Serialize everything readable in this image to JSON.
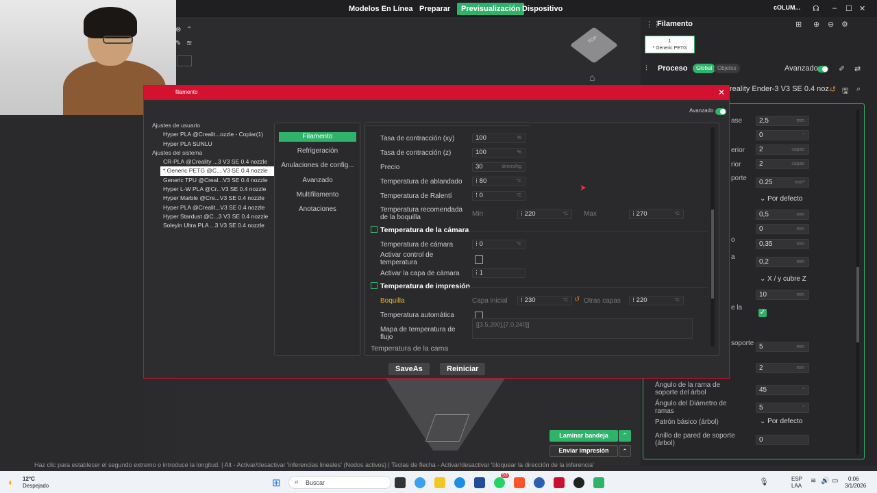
{
  "topbar": {
    "nav": [
      "Modelos En Línea",
      "Preparar",
      "Previsualización",
      "Dispositivo"
    ],
    "active_nav": "Previsualización",
    "user": "cOLUM..."
  },
  "right_panel": {
    "filament_title": "Filamento",
    "filament_slot_number": "1",
    "filament_slot_name": "* Generic PETG",
    "process_title": "Proceso",
    "global_label": "Global",
    "objects_label": "Objetos",
    "advanced_label": "Avanzado",
    "printer_preset": "reality Ender-3 V3 SE 0.4 noz...",
    "rows": [
      {
        "label": "ase",
        "value": "2,5",
        "unit": "mm"
      },
      {
        "label": "",
        "value": "0",
        "unit": "°"
      },
      {
        "label": "erior",
        "value": "2",
        "unit": "capas"
      },
      {
        "label": "rior",
        "value": "2",
        "unit": "capas"
      },
      {
        "label": "porte",
        "value": "0.25",
        "unit": "mm²"
      },
      {
        "label": "",
        "value": "Por defecto",
        "unit": ""
      },
      {
        "label": "",
        "value": "0,5",
        "unit": "mm"
      },
      {
        "label": "",
        "value": "0",
        "unit": "mm"
      },
      {
        "label": "o",
        "value": "0,35",
        "unit": "mm"
      },
      {
        "label": "a",
        "value": "0,2",
        "unit": "mm"
      },
      {
        "label": "",
        "value": "X / y cubre Z",
        "unit": ""
      },
      {
        "label": "",
        "value": "10",
        "unit": "mm"
      },
      {
        "label": "e la",
        "value": "",
        "unit": ""
      },
      {
        "label": "soporte",
        "value": "5",
        "unit": "mm"
      },
      {
        "label": "",
        "value": "2",
        "unit": "mm"
      },
      {
        "label": "Ángulo de la rama de soporte del árbol",
        "value": "45",
        "unit": "°"
      },
      {
        "label": "Ángulo del Diámetro de ramas",
        "value": "5",
        "unit": "°"
      },
      {
        "label": "Patrón básico (árbol)",
        "value": "Por defecto",
        "unit": ""
      },
      {
        "label": "Anillo de pared de soporte (árbol)",
        "value": "0",
        "unit": ""
      }
    ],
    "slice_button": "Laminar bandeja",
    "send_button": "Enviar impresión"
  },
  "viewport": {
    "cube_label": "TOP"
  },
  "status_line": "Haz clic para establecer el segundo extremo o introduce la longitud. | Alt - Activar/desactivar 'inferencias lineales' (Nodos activos) | Teclas de flecha - Activar/desactivar 'bloquear la dirección de la inferencia'",
  "dialog": {
    "title": "filamento",
    "advanced_label": "Avanzado",
    "preset_groups": [
      {
        "label": "Ajustes de usuario",
        "items": [
          "Hyper PLA @Crealit...ozzle - Copiar(1)",
          "Hyper PLA SUNLU"
        ]
      },
      {
        "label": "Ajustes del sistema",
        "items": [
          "CR-PLA @Creality ...3 V3 SE 0.4 nozzle",
          "* Generic PETG @C... V3 SE 0.4 nozzle",
          "Generic TPU @Creal...V3 SE 0.4 nozzle",
          "Hyper L-W PLA @Cr...V3 SE 0.4 nozzle",
          "Hyper Marble @Cre...V3 SE 0.4 nozzle",
          "Hyper PLA @Crealit...V3 SE 0.4 nozzle",
          "Hyper Stardust @C...3 V3 SE 0.4 nozzle",
          "Soleyin Ultra PLA ...3 V3 SE 0.4 nozzle"
        ]
      }
    ],
    "selected_preset": "* Generic PETG @C... V3 SE 0.4 nozzle",
    "tabs": [
      "Filamento",
      "Refrigeración",
      "Anulaciones de config...",
      "Avanzado",
      "Multifilamento",
      "Anotaciones"
    ],
    "active_tab": "Filamento",
    "fields": {
      "shrink_xy": {
        "label": "Tasa de contracción (xy)",
        "value": "100",
        "unit": "%"
      },
      "shrink_z": {
        "label": "Tasa de contracción (z)",
        "value": "100",
        "unit": "%"
      },
      "price": {
        "label": "Precio",
        "value": "30",
        "unit": "dinero/kg"
      },
      "softening": {
        "label": "Temperatura de ablandado",
        "value": "80",
        "unit": "°C"
      },
      "idle": {
        "label": "Temperatura de Ralentí",
        "value": "0",
        "unit": "°C"
      },
      "recommended": {
        "label": "Temperatura recomendada de la boquilla",
        "min_label": "Min",
        "min": "220",
        "max_label": "Max",
        "max": "270",
        "unit": "°C"
      }
    },
    "chamber_section": "Temperatura de la cámara",
    "chamber": {
      "temp_label": "Temperatura de cámara",
      "temp_value": "0",
      "unit": "°C",
      "control_label": "Activar control de temperatura",
      "layer_label": "Activar la capa de cámara",
      "layer_value": "1"
    },
    "print_section": "Temperatura de impresión",
    "print": {
      "nozzle_label": "Boquilla",
      "initial_label": "Capa inicial",
      "initial_value": "230",
      "other_label": "Otras capas",
      "other_value": "220",
      "unit": "°C",
      "auto_label": "Temperatura automática",
      "flow_map_label": "Mapa de temperatura de flujo",
      "flow_map_value": "[[3.5,200],[7.0,240]]"
    },
    "cut_section": "Temperatura de la cama",
    "save_as": "SaveAs",
    "reset": "Reiniciar"
  },
  "taskbar": {
    "weather_temp": "12°C",
    "weather_desc": "Despejado",
    "search_placeholder": "Buscar",
    "badge": "93",
    "lang": "ESP",
    "lang_sub": "LAA",
    "time": "0:06",
    "date": "3/1/2026"
  },
  "colors": {
    "accent": "#2fb36b",
    "dialog_red": "#d4122f",
    "highlight_yellow": "#e5b62f"
  }
}
